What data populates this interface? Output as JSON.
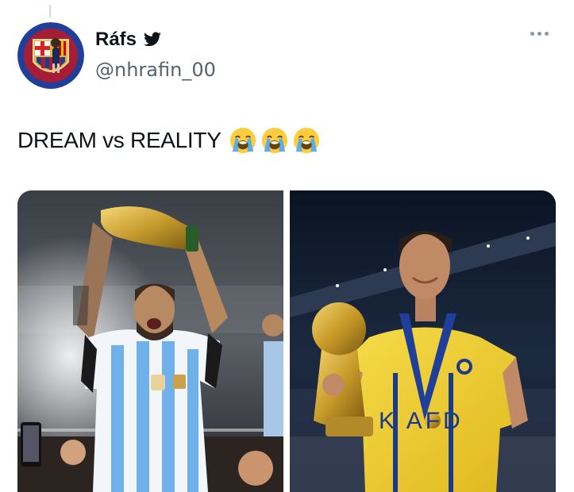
{
  "user": {
    "display_name": "Ráfs",
    "handle": "@nhrafin_00",
    "verified_icon": "twitter-bird-icon"
  },
  "tweet": {
    "text": "DREAM vs REALITY",
    "emojis": [
      "loudly-crying-face",
      "loudly-crying-face",
      "loudly-crying-face"
    ]
  },
  "media": {
    "left_photo": "messi-holding-world-cup-trophy",
    "right_photo": "ronaldo-holding-trophy-al-nassr-kit"
  },
  "colors": {
    "text": "#0f1419",
    "secondary": "#536471",
    "twitter_blue": "#1d9bf0",
    "jersey_yellow": "#f2d23b"
  }
}
